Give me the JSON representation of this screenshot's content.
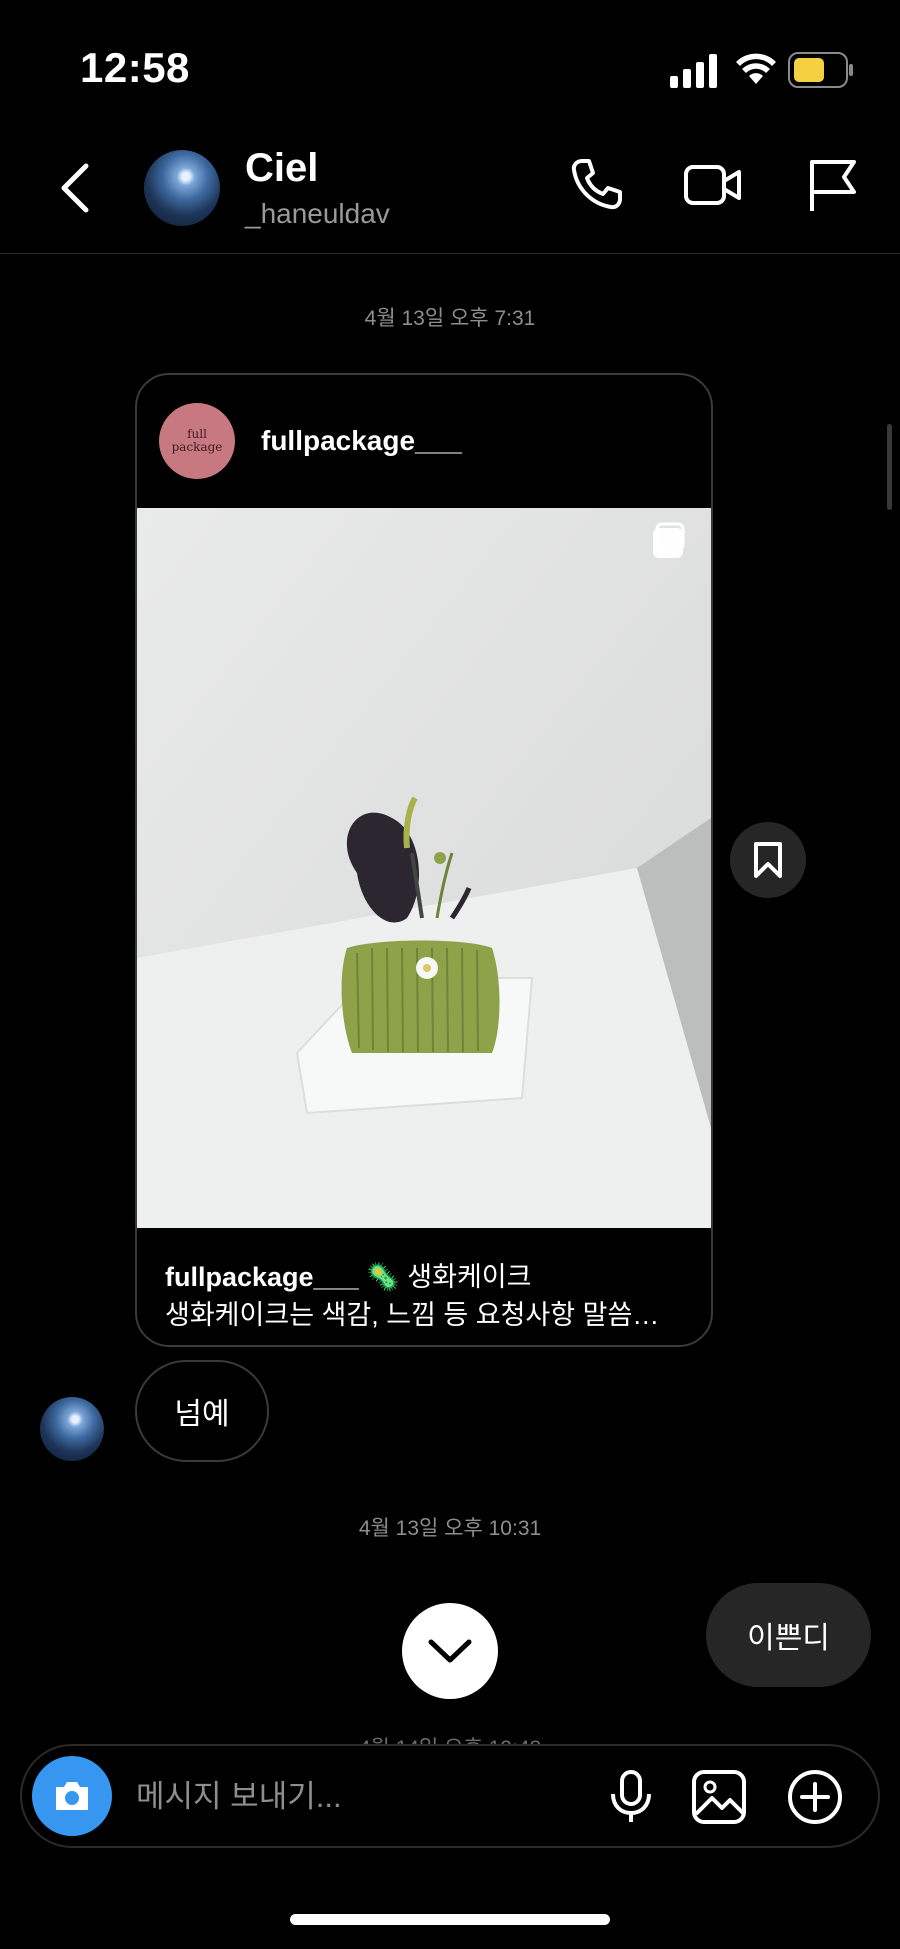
{
  "status_bar": {
    "time": "12:58"
  },
  "header": {
    "name": "Ciel",
    "username": "_haneuldav",
    "icons": [
      "back-chevron-icon",
      "phone-icon",
      "video-call-icon",
      "flag-icon"
    ]
  },
  "messages": {
    "timestamp1": "4월 13일 오후 7:31",
    "shared_post": {
      "avatar_text_line1": "full",
      "avatar_text_line2": "package",
      "username": "fullpackage___",
      "caption_user": "fullpackage___",
      "caption_emoji": "🦠",
      "caption_title": "생화케이크",
      "caption_line2": "생화케이크는 색감, 느낌 등 요청사항 말씀…"
    },
    "reply_in": "넘예",
    "timestamp2": "4월 13일 오후 10:31",
    "reply_out": "이쁜디",
    "timestamp3_partial": "4월 14일 오후 12:48"
  },
  "composer": {
    "placeholder": "메시지 보내기...",
    "value": ""
  },
  "colors": {
    "background": "#000000",
    "bubble_out": "#262626",
    "camera_button": "#3797f0",
    "battery": "#f5d142",
    "secondary_text": "#8e8e8e"
  }
}
